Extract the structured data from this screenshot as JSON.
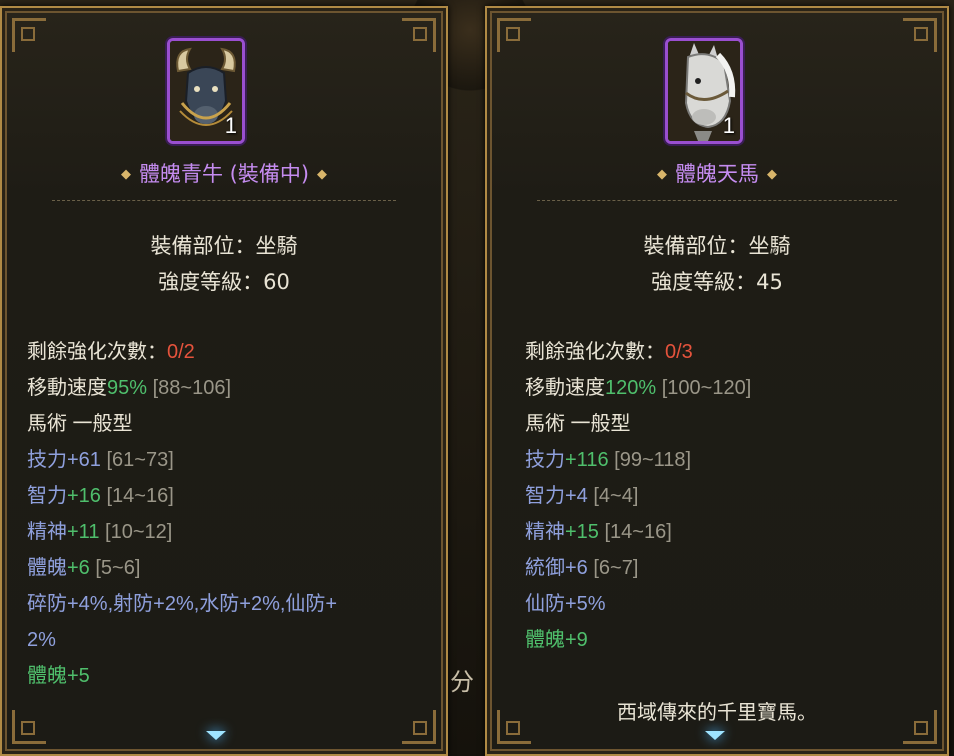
{
  "background": {
    "partial_text": "分"
  },
  "left_card": {
    "icon": "ox-mount-icon",
    "count": "1",
    "name": "體魄青牛 (裝備中)",
    "slot": "裝備部位：坐騎",
    "level": "強度等級：60",
    "upgrades": {
      "label": "剩餘強化次數：",
      "value": "0/2"
    },
    "speed": {
      "label": "移動速度",
      "value": "95%",
      "range": " [88~106]"
    },
    "type_line": "馬術 一般型",
    "attributes": [
      {
        "label": "技力",
        "value": "+61",
        "range": " [61~73]"
      },
      {
        "label": "智力",
        "value": "+16",
        "range": " [14~16]"
      },
      {
        "label": "精神",
        "value": "+11",
        "range": " [10~12]"
      },
      {
        "label": "體魄",
        "value": "+6",
        "range": " [5~6]"
      }
    ],
    "resist_line1": "碎防+4%,射防+2%,水防+2%,仙防+",
    "resist_line2": "2%",
    "bonus": "體魄+5"
  },
  "right_card": {
    "icon": "white-horse-mount-icon",
    "count": "1",
    "name": "體魄天馬",
    "slot": "裝備部位：坐騎",
    "level": "強度等級：45",
    "upgrades": {
      "label": "剩餘強化次數：",
      "value": "0/3"
    },
    "speed": {
      "label": "移動速度",
      "value": "120%",
      "range": " [100~120]"
    },
    "type_line": "馬術 一般型",
    "attributes": [
      {
        "label": "技力",
        "value": "+116",
        "range": " [99~118]"
      },
      {
        "label": "智力",
        "value": "+4",
        "range": " [4~4]"
      },
      {
        "label": "精神",
        "value": "+15",
        "range": " [14~16]"
      },
      {
        "label": "統御",
        "value": "+6",
        "range": " [6~7]"
      }
    ],
    "resist_line1": "仙防+5%",
    "bonus": "體魄+9",
    "description": "西域傳來的千里寶馬。"
  },
  "colors": {
    "frame_gold": "#b08a45",
    "rarity_purple": "#c58cf0",
    "stat_blue": "#8fa0dd",
    "stat_green": "#4fbf6c",
    "stat_red": "#e5533c",
    "range_gray": "#9a9688"
  }
}
